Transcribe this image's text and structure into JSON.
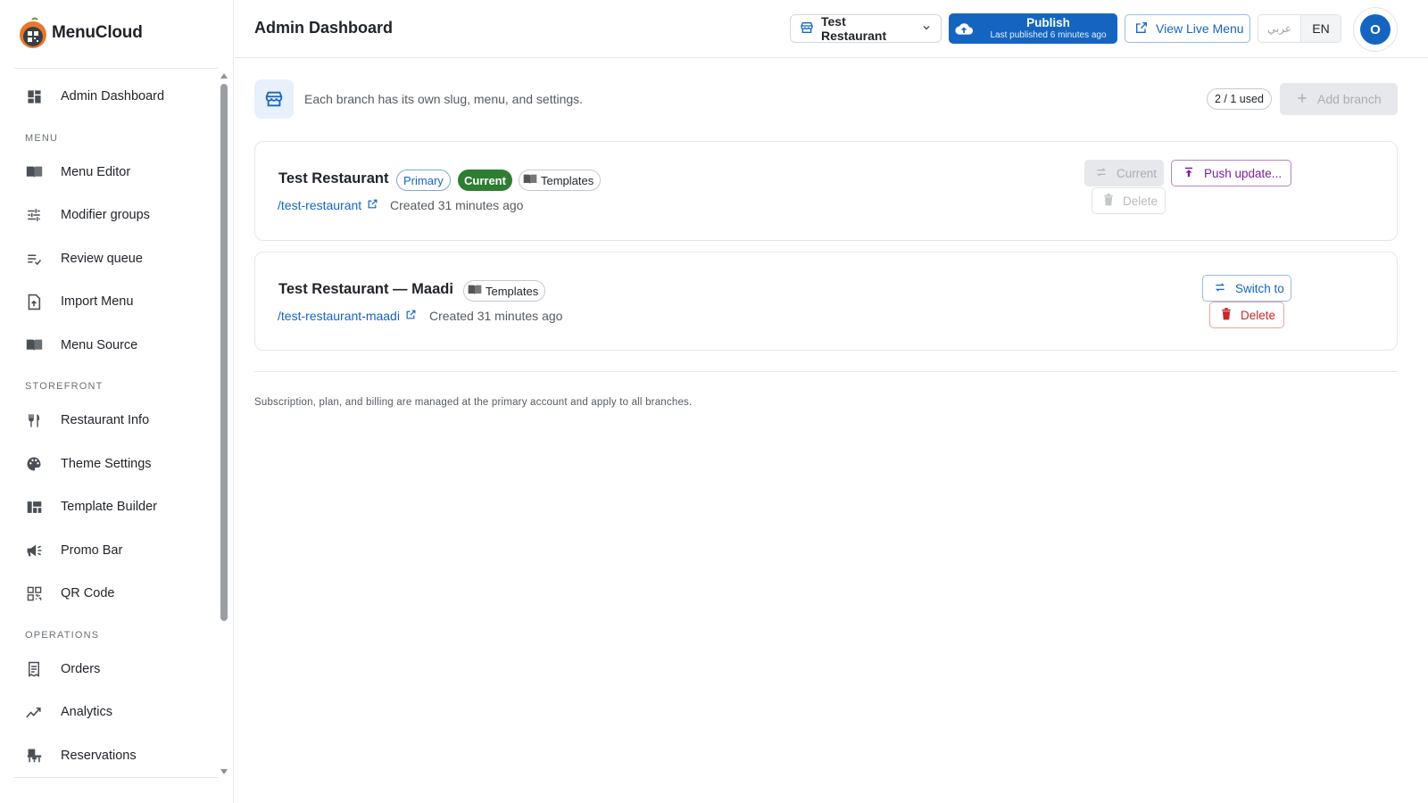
{
  "app": {
    "brand_name": "MenuCloud"
  },
  "sidebar": {
    "items": [
      {
        "type": "item",
        "label": "Admin Dashboard",
        "icon": "dashboard-icon"
      },
      {
        "type": "section",
        "label": "MENU"
      },
      {
        "type": "item",
        "label": "Menu Editor",
        "icon": "menu-book-icon"
      },
      {
        "type": "item",
        "label": "Modifier groups",
        "icon": "tune-icon"
      },
      {
        "type": "item",
        "label": "Review queue",
        "icon": "playlist-check-icon"
      },
      {
        "type": "item",
        "label": "Import Menu",
        "icon": "file-upload-icon"
      },
      {
        "type": "item",
        "label": "Menu Source",
        "icon": "menu-book-icon"
      },
      {
        "type": "section",
        "label": "STOREFRONT"
      },
      {
        "type": "item",
        "label": "Restaurant Info",
        "icon": "restaurant-icon"
      },
      {
        "type": "item",
        "label": "Theme Settings",
        "icon": "palette-icon"
      },
      {
        "type": "item",
        "label": "Template Builder",
        "icon": "grid-layout-icon"
      },
      {
        "type": "item",
        "label": "Promo Bar",
        "icon": "megaphone-icon"
      },
      {
        "type": "item",
        "label": "QR Code",
        "icon": "qr-code-icon"
      },
      {
        "type": "section",
        "label": "OPERATIONS"
      },
      {
        "type": "item",
        "label": "Orders",
        "icon": "receipt-icon"
      },
      {
        "type": "item",
        "label": "Analytics",
        "icon": "trending-icon"
      },
      {
        "type": "item",
        "label": "Reservations",
        "icon": "table-chair-icon"
      }
    ]
  },
  "header": {
    "title": "Admin Dashboard",
    "branch_select": "Test Restaurant",
    "publish_label": "Publish",
    "publish_sub": "Last published 6 minutes ago",
    "view_live_label": "View Live Menu",
    "lang_ar": "عربي",
    "lang_en": "EN",
    "avatar_initial": "O"
  },
  "main": {
    "info_text": "Each branch has its own slug, menu, and settings.",
    "used_count": "2 / 1 used",
    "add_branch_label": "Add branch",
    "branches": [
      {
        "name": "Test Restaurant",
        "primary_label": "Primary",
        "current_label": "Current",
        "templates_label": "Templates",
        "slug": "/test-restaurant",
        "created": "Created 31 minutes ago",
        "current_btn": "Current",
        "push_btn": "Push update...",
        "delete_btn": "Delete"
      },
      {
        "name": "Test Restaurant — Maadi",
        "templates_label": "Templates",
        "slug": "/test-restaurant-maadi",
        "created": "Created 31 minutes ago",
        "switch_btn": "Switch to",
        "delete_btn": "Delete"
      }
    ],
    "footnote": "Subscription, plan, and billing are managed at the primary account and apply to all branches."
  },
  "colors": {
    "primary": "#1565c0",
    "success": "#2e7d32",
    "danger": "#c62828",
    "purple": "#7b1fa2",
    "brand_orange": "#e8772e"
  }
}
